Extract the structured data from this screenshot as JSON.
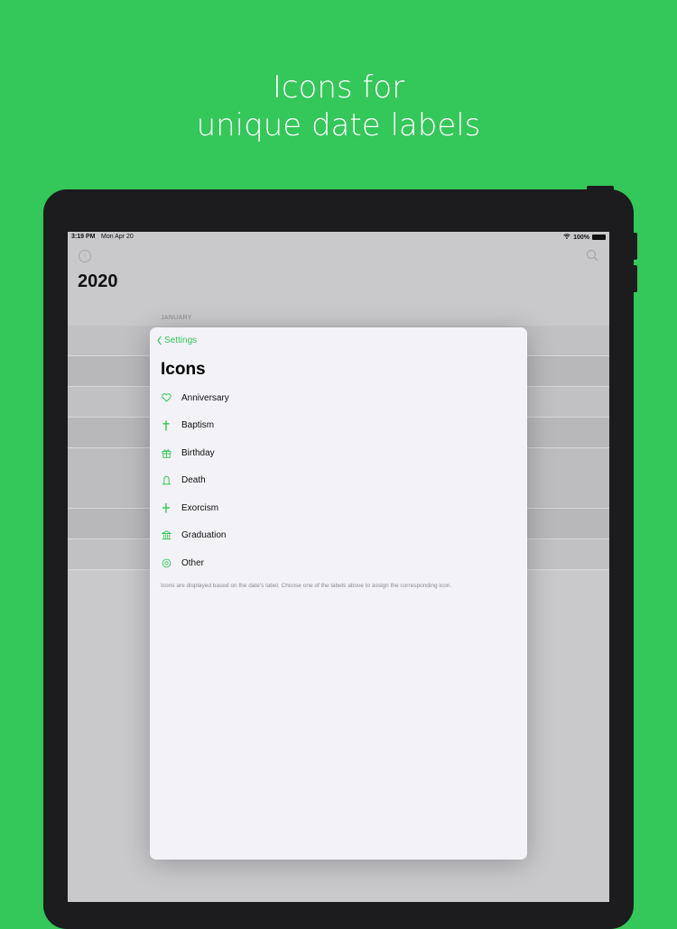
{
  "headline": {
    "line1": "Icons for",
    "line2": "unique date labels"
  },
  "status_bar": {
    "time": "3:19 PM",
    "date": "Mon Apr 20",
    "battery": "100%",
    "icons": [
      "wifi-icon",
      "battery-icon"
    ]
  },
  "background_screen": {
    "title": "2020",
    "section_header": "JANUARY",
    "left_icon": "info-circle-icon",
    "right_icon": "search-icon"
  },
  "modal": {
    "back_label": "Settings",
    "title": "Icons",
    "items": [
      {
        "label": "Anniversary",
        "icon": "heart-icon"
      },
      {
        "label": "Baptism",
        "icon": "cross-icon"
      },
      {
        "label": "Birthday",
        "icon": "gift-icon"
      },
      {
        "label": "Death",
        "icon": "tombstone-icon"
      },
      {
        "label": "Exorcism",
        "icon": "dagger-icon"
      },
      {
        "label": "Graduation",
        "icon": "institution-icon"
      },
      {
        "label": "Other",
        "icon": "circle-dot-icon"
      }
    ],
    "footnote": "Icons are displayed based on the date's label. Choose one of the labels above to assign the corresponding icon."
  },
  "colors": {
    "background": "#34c759",
    "accent": "#34c759",
    "device": "#1c1c1e",
    "modal_bg": "#f2f2f7"
  }
}
